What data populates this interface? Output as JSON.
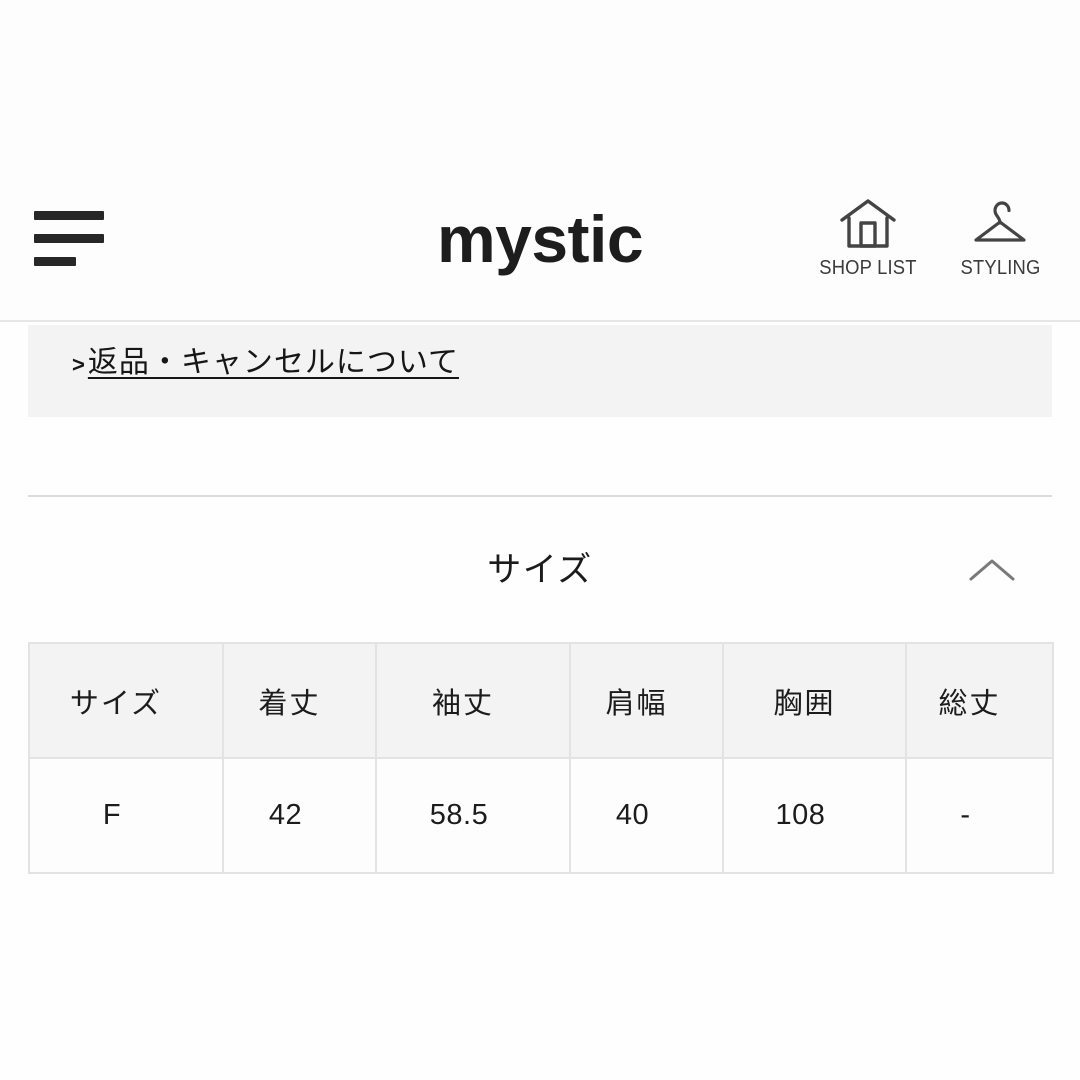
{
  "header": {
    "menu_icon": "hamburger-menu-icon",
    "brand": "mystic",
    "actions": [
      {
        "icon": "shop-house-icon",
        "label": "SHOP LIST"
      },
      {
        "icon": "clothes-hanger-icon",
        "label": "STYLING"
      }
    ]
  },
  "notice": {
    "arrow": ">",
    "link_label": "返品・キャンセルについて"
  },
  "size_section": {
    "title": "サイズ",
    "toggle_icon": "chevron-up-icon",
    "expanded": true
  },
  "size_table": {
    "columns": [
      "サイズ",
      "着丈",
      "袖丈",
      "肩幅",
      "胸囲",
      "総丈"
    ],
    "rows": [
      [
        "F",
        "42",
        "58.5",
        "40",
        "108",
        "-"
      ]
    ]
  },
  "colors": {
    "page_background": "#fefefe",
    "panel_gray": "#f3f3f3",
    "table_header_gray": "#f3f3f3",
    "border_gray": "#e3e3e3",
    "divider_gray": "#dcdcdc",
    "text_dark": "#1b1b1b",
    "icon_gray": "#444444"
  }
}
